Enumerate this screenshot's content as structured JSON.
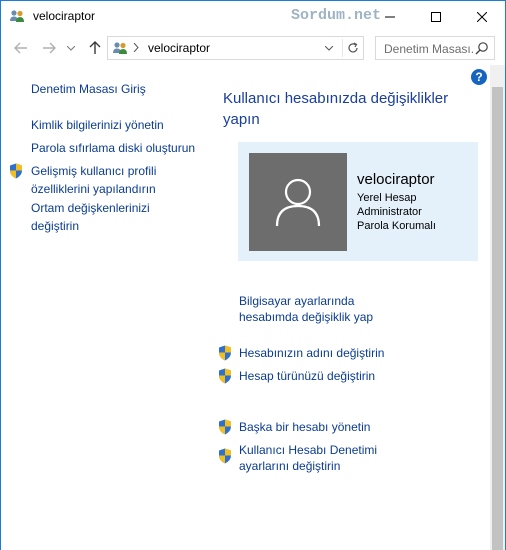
{
  "window": {
    "title": "velociraptor",
    "watermark": "Sordum.net"
  },
  "nav": {
    "address_text": "velociraptor",
    "search_placeholder": "Denetim Masası..."
  },
  "sidebar": {
    "items": [
      {
        "label": "Denetim Masası Giriş"
      },
      {
        "label": "Kimlik bilgilerinizi yönetin"
      },
      {
        "label": "Parola sıfırlama diski oluşturun"
      },
      {
        "label_line1": "Gelişmiş kullanıcı profili",
        "label_line2": "özelliklerini yapılandırın"
      },
      {
        "label_line1": "Ortam değişkenlerinizi",
        "label_line2": "değiştirin"
      }
    ]
  },
  "main": {
    "heading_line1": "Kullanıcı hesabınızda değişiklikler",
    "heading_line2": "yapın",
    "user": {
      "name": "velociraptor",
      "account_type": "Yerel Hesap",
      "role": "Administrator",
      "password_status": "Parola Korumalı"
    },
    "links": [
      {
        "line1": "Bilgisayar ayarlarında",
        "line2": "hesabımda değişiklik yap"
      },
      {
        "line1": "Hesabınızın adını değiştirin"
      },
      {
        "line1": "Hesap türünüzü değiştirin"
      },
      {
        "line1": "Başka bir hesabı yönetin"
      },
      {
        "line1": "Kullanıcı Hesabı Denetimi",
        "line2": "ayarlarını değiştirin"
      }
    ]
  },
  "colors": {
    "link": "#0b3c91",
    "heading": "#1a3e9e",
    "user_panel": "#e4f1fb",
    "avatar": "#6d6d6d",
    "window_border": "#1a7fd4"
  },
  "icons": [
    "users-icon",
    "minimize-icon",
    "maximize-icon",
    "close-icon",
    "back-arrow-icon",
    "forward-arrow-icon",
    "up-arrow-icon",
    "refresh-icon",
    "search-icon",
    "help-icon",
    "shield-icon",
    "user-silhouette-icon"
  ]
}
